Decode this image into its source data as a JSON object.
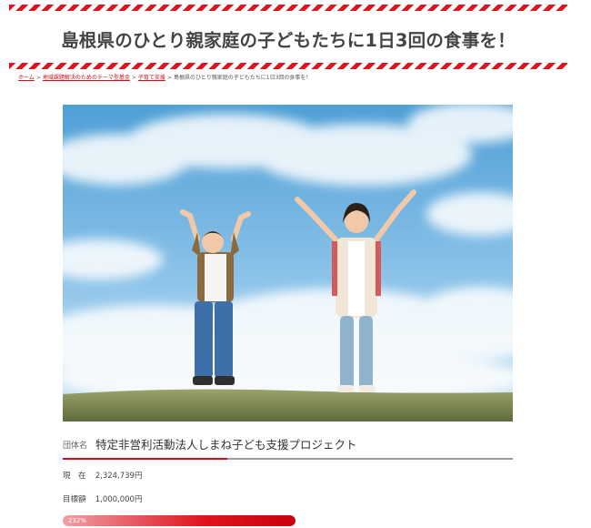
{
  "page": {
    "title": "島根県のひとり親家庭の子どもたちに1日3回の食事を！"
  },
  "breadcrumb": {
    "items": [
      "ホーム",
      "地域課題解決のためのテーマ型基金",
      "子育て支援",
      "島根県のひとり親家庭の子どもたちに1日3回の食事を！"
    ]
  },
  "hero": {
    "icon": "hero-photo-children-jumping"
  },
  "organization": {
    "label": "団体名",
    "name": "特定非営利活動法人しまね子ども支援プロジェクト"
  },
  "funding": {
    "current_label": "現　在",
    "current_value": "2,324,739円",
    "goal_label": "目標額",
    "goal_value": "1,000,000円",
    "progress_text": "232%",
    "progress_fraction": 1.0
  },
  "colors": {
    "accent": "#e0141e",
    "link": "#d0101b"
  }
}
